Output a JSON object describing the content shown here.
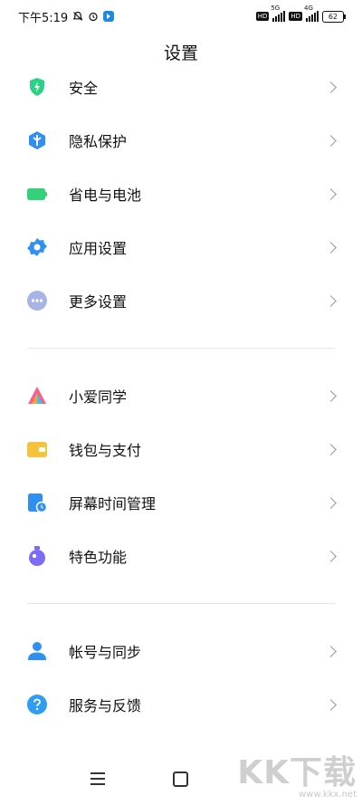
{
  "status_bar": {
    "time": "下午5:19",
    "hd1": "HD",
    "net1": "5G",
    "hd2": "HD",
    "net2": "4G",
    "battery": "62"
  },
  "title": "设置",
  "group1": [
    {
      "label": "安全"
    },
    {
      "label": "隐私保护"
    },
    {
      "label": "省电与电池"
    },
    {
      "label": "应用设置"
    },
    {
      "label": "更多设置"
    }
  ],
  "group2": [
    {
      "label": "小爱同学"
    },
    {
      "label": "钱包与支付"
    },
    {
      "label": "屏幕时间管理"
    },
    {
      "label": "特色功能"
    }
  ],
  "group3": [
    {
      "label": "帐号与同步"
    },
    {
      "label": "服务与反馈"
    }
  ],
  "watermark": {
    "logo": "KK下载",
    "url": "www.kkx.net"
  },
  "colors": {
    "security": "#2bd184",
    "privacy": "#2f8ff2",
    "battery": "#34d17c",
    "app_settings": "#2f8ff2",
    "more": "#a9b4e6",
    "xiaoai": "#ff5a8a",
    "wallet": "#f7c23b",
    "screen_time": "#2f8ff2",
    "features": "#7b6cf5",
    "account": "#2f8ff2",
    "service": "#2f9df2"
  }
}
